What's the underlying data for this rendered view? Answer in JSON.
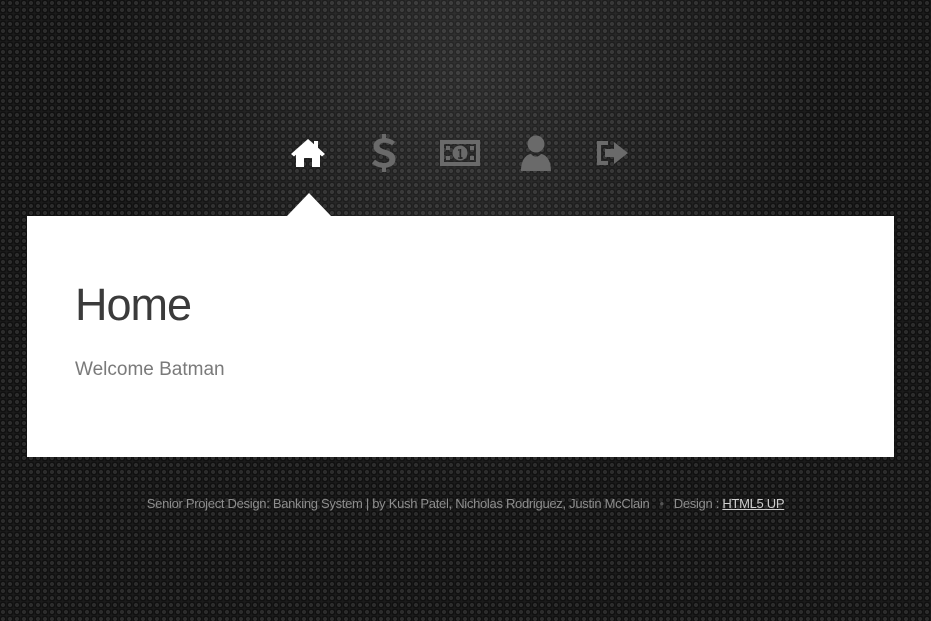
{
  "nav": {
    "items": [
      {
        "icon": "home-icon",
        "active": true
      },
      {
        "icon": "dollar-icon",
        "active": false
      },
      {
        "icon": "money-bill-icon",
        "active": false
      },
      {
        "icon": "user-icon",
        "active": false
      },
      {
        "icon": "sign-out-icon",
        "active": false
      }
    ]
  },
  "main": {
    "title": "Home",
    "welcome": "Welcome Batman"
  },
  "footer": {
    "credit": "Senior Project Design: Banking System | by Kush Patel, Nicholas Rodriguez, Justin McClain",
    "separator": "•",
    "design_prefix": "Design : ",
    "design_link": "HTML5 UP"
  },
  "colors": {
    "active_icon": "#ffffff",
    "inactive_icon": "#6a6a6a",
    "panel_bg": "#ffffff",
    "title": "#3b3b3b",
    "body_text": "#7a7a7a",
    "footer_text": "#8d8d8d"
  }
}
